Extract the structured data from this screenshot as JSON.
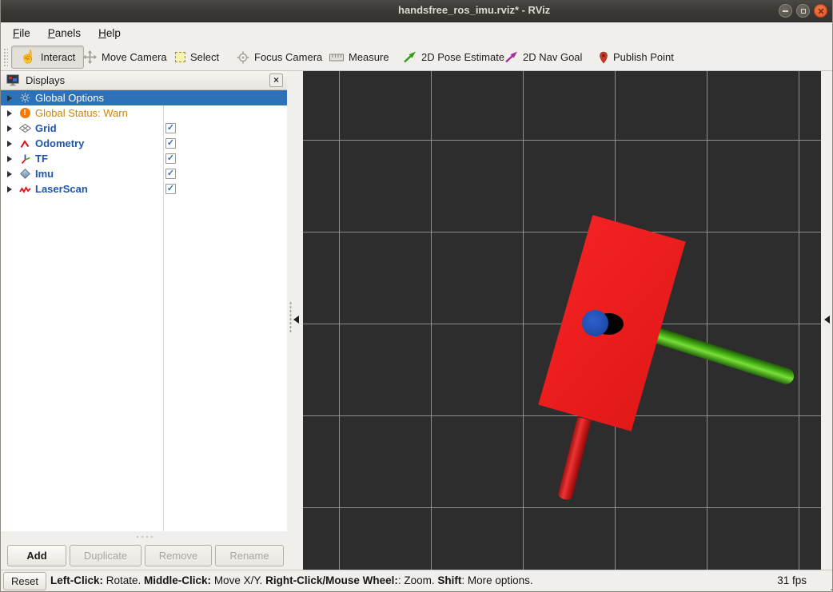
{
  "window": {
    "title": "handsfree_ros_imu.rviz* - RViz"
  },
  "menu": {
    "items": [
      {
        "key": "F",
        "rest": "ile"
      },
      {
        "key": "P",
        "rest": "anels"
      },
      {
        "key": "H",
        "rest": "elp"
      }
    ]
  },
  "toolbar": {
    "buttons": [
      {
        "label": "Interact",
        "active": true
      },
      {
        "label": "Move Camera"
      },
      {
        "label": "Select"
      },
      {
        "label": "Focus Camera"
      },
      {
        "label": "Measure"
      },
      {
        "label": "2D Pose Estimate",
        "color": "#2f9e15"
      },
      {
        "label": "2D Nav Goal",
        "color": "#ab2b98"
      },
      {
        "label": "Publish Point",
        "color": "#c63a1e"
      }
    ]
  },
  "displays": {
    "title": "Displays",
    "close_glyph": "×",
    "expander_glyph": "",
    "check_glyph": "✓",
    "rows": [
      {
        "label": "Global Options",
        "selected": true
      },
      {
        "label": "Global Status: Warn",
        "warn": true
      },
      {
        "label": "Grid",
        "checked": true
      },
      {
        "label": "Odometry",
        "checked": true
      },
      {
        "label": "TF",
        "checked": true
      },
      {
        "label": "Imu",
        "checked": true
      },
      {
        "label": "LaserScan",
        "checked": true
      }
    ],
    "buttons": [
      {
        "label": "Add",
        "enabled": true
      },
      {
        "label": "Duplicate",
        "enabled": false
      },
      {
        "label": "Remove",
        "enabled": false
      },
      {
        "label": "Rename",
        "enabled": false
      }
    ]
  },
  "statusbar": {
    "reset_label": "Reset",
    "help": [
      {
        "b": "Left-Click:",
        "t": " Rotate. "
      },
      {
        "b": "Middle-Click:",
        "t": " Move X/Y. "
      },
      {
        "b": "Right-Click/Mouse Wheel:",
        "t": ": Zoom. "
      },
      {
        "b": "Shift",
        "t": ": More options."
      }
    ],
    "fps": "31 fps"
  },
  "scene": {
    "background": "#2d2d2d",
    "grid_color": "#a5a5a5",
    "objects": [
      {
        "name": "imu-board-box",
        "shape": "box",
        "color": "#ec1e1e"
      },
      {
        "name": "red-axis-cylinder",
        "shape": "cylinder",
        "color": "#d21414"
      },
      {
        "name": "green-axis-cylinder",
        "shape": "cylinder",
        "color": "#55c41d"
      },
      {
        "name": "blue-axis-disc",
        "shape": "disc",
        "color": "#2351b5"
      }
    ]
  },
  "colors": {
    "selection": "#2d71b8",
    "display_label": "#1d56ad",
    "warn_text": "#c8860b",
    "close_button": "#ef6136"
  }
}
